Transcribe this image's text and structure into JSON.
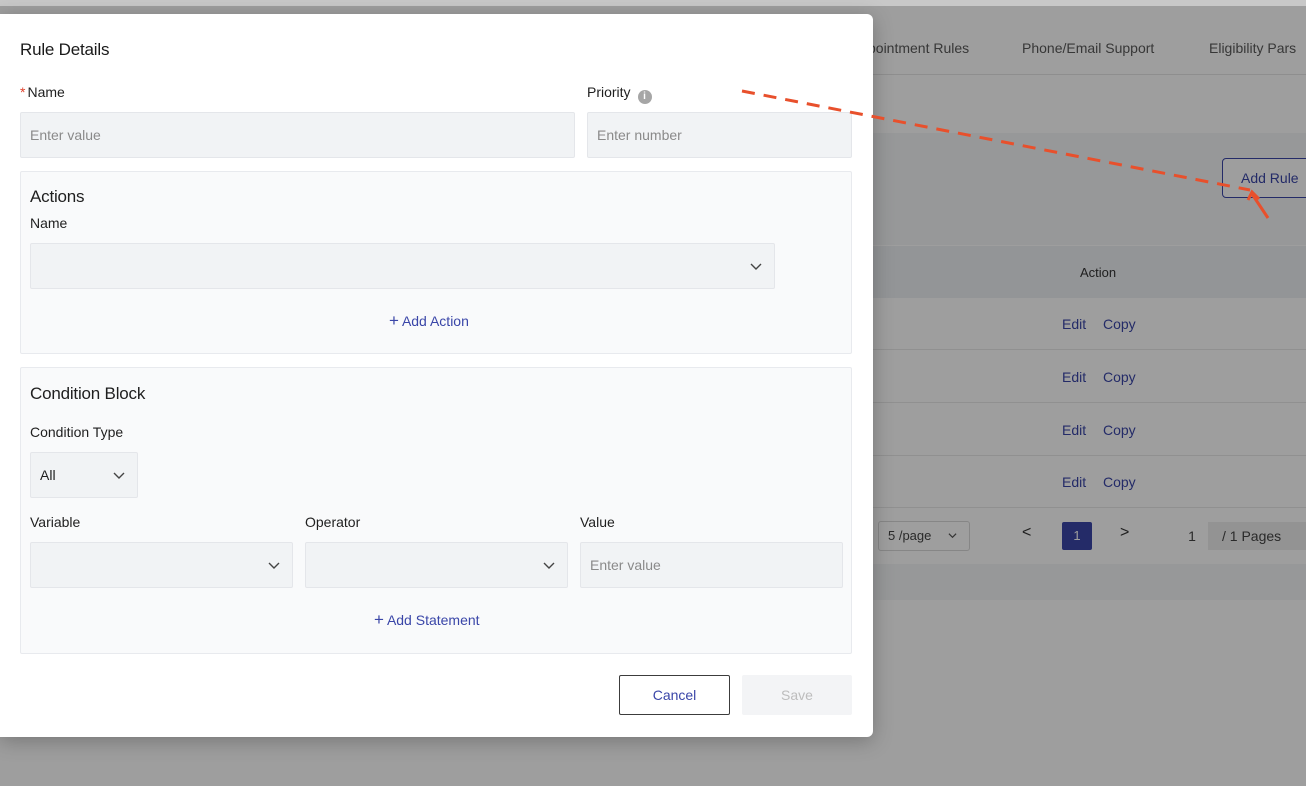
{
  "background": {
    "tabs": [
      "pointment Rules",
      "Phone/Email Support",
      "Eligibility Pars"
    ],
    "add_rule_label": "Add Rule",
    "table_header_action": "Action",
    "rows": [
      {
        "edit": "Edit",
        "copy": "Copy"
      },
      {
        "edit": "Edit",
        "copy": "Copy"
      },
      {
        "edit": "Edit",
        "copy": "Copy"
      },
      {
        "edit": "Edit",
        "copy": "Copy"
      }
    ],
    "pagination": {
      "page_size": "5 /page",
      "prev": "<",
      "current_page": "1",
      "next": ">",
      "goto_value": "1",
      "total_pages": "/ 1 Pages"
    }
  },
  "modal": {
    "title": "Rule Details",
    "name_required_mark": "*",
    "name_label": "Name",
    "name_placeholder": "Enter value",
    "priority_label": "Priority",
    "priority_info": "i",
    "priority_placeholder": "Enter number",
    "actions": {
      "title": "Actions",
      "name_label": "Name",
      "name_value": "",
      "add_action_plus": "+",
      "add_action_label": "Add Action"
    },
    "condition_block": {
      "title": "Condition Block",
      "condition_type_label": "Condition Type",
      "condition_type_value": "All",
      "variable_label": "Variable",
      "variable_value": "",
      "operator_label": "Operator",
      "operator_value": "",
      "value_label": "Value",
      "value_placeholder": "Enter value",
      "add_statement_plus": "+",
      "add_statement_label": "Add Statement"
    },
    "cancel_label": "Cancel",
    "save_label": "Save"
  },
  "colors": {
    "accent": "#3a46a8",
    "annotation": "#e8502c",
    "required": "#e0402a"
  },
  "icons": [
    "chevron-down-icon",
    "info-icon",
    "plus-icon",
    "chevron-left-icon",
    "chevron-right-icon"
  ]
}
